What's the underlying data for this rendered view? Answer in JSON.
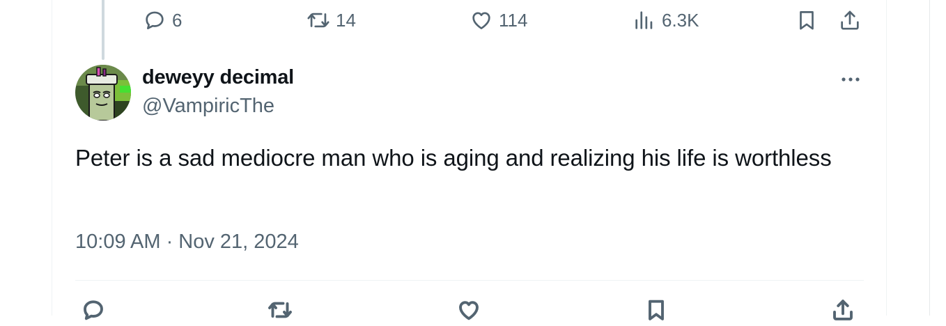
{
  "previous_tweet_actions": {
    "replies": "6",
    "retweets": "14",
    "likes": "114",
    "views": "6.3K"
  },
  "tweet": {
    "display_name": "deweyy decimal",
    "handle": "@VampiricThe",
    "text": "Peter is a sad mediocre man who is aging and realizing his life is worthless",
    "timestamp": "10:09 AM · Nov 21, 2024"
  },
  "icons": {
    "reply": "reply-icon",
    "retweet": "retweet-icon",
    "like": "heart-icon",
    "views": "views-icon",
    "bookmark": "bookmark-icon",
    "share": "share-icon",
    "more": "more-icon"
  },
  "colors": {
    "text_primary": "#0f1419",
    "text_secondary": "#536471",
    "border": "#eff3f4",
    "thread_line": "#cfd9de"
  }
}
